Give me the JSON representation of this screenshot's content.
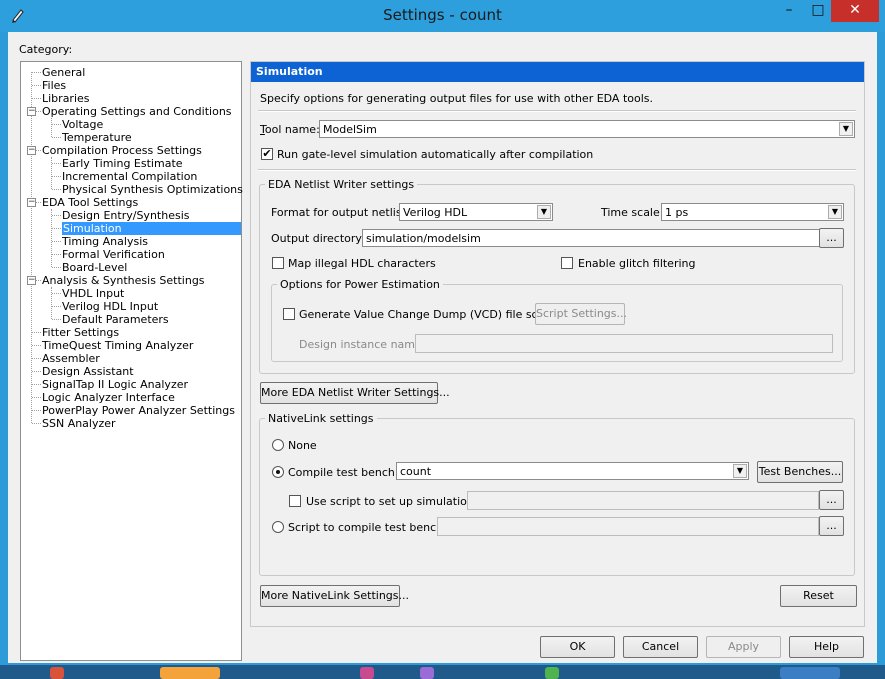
{
  "window": {
    "title": "Settings - count"
  },
  "titlebar": {
    "minimize": "–",
    "maximize": "□",
    "close": "✕"
  },
  "category_label": "Category:",
  "tree": [
    {
      "label": "General"
    },
    {
      "label": "Files"
    },
    {
      "label": "Libraries"
    },
    {
      "label": "Operating Settings and Conditions"
    },
    {
      "label": "Voltage"
    },
    {
      "label": "Temperature"
    },
    {
      "label": "Compilation Process Settings"
    },
    {
      "label": "Early Timing Estimate"
    },
    {
      "label": "Incremental Compilation"
    },
    {
      "label": "Physical Synthesis Optimizations"
    },
    {
      "label": "EDA Tool Settings"
    },
    {
      "label": "Design Entry/Synthesis"
    },
    {
      "label": "Simulation"
    },
    {
      "label": "Timing Analysis"
    },
    {
      "label": "Formal Verification"
    },
    {
      "label": "Board-Level"
    },
    {
      "label": "Analysis & Synthesis Settings"
    },
    {
      "label": "VHDL Input"
    },
    {
      "label": "Verilog HDL Input"
    },
    {
      "label": "Default Parameters"
    },
    {
      "label": "Fitter Settings"
    },
    {
      "label": "TimeQuest Timing Analyzer"
    },
    {
      "label": "Assembler"
    },
    {
      "label": "Design Assistant"
    },
    {
      "label": "SignalTap II Logic Analyzer"
    },
    {
      "label": "Logic Analyzer Interface"
    },
    {
      "label": "PowerPlay Power Analyzer Settings"
    },
    {
      "label": "SSN Analyzer"
    }
  ],
  "panel": {
    "title": "Simulation",
    "description": "Specify options for generating output files for use with other EDA tools.",
    "tool_name_label": "Tool name:",
    "tool_name_value": "ModelSim",
    "run_gate_level_label": "Run gate-level simulation automatically after compilation",
    "run_gate_level_checked": "✔",
    "netlist_group": {
      "title": "EDA Netlist Writer settings",
      "format_label": "Format for output netlist:",
      "format_value": "Verilog HDL",
      "time_scale_label": "Time scale:",
      "time_scale_value": "1 ps",
      "output_dir_label": "Output directory:",
      "output_dir_value": "simulation/modelsim",
      "browse": "...",
      "map_illegal_label": "Map illegal HDL characters",
      "glitch_label": "Enable glitch filtering",
      "power_group": {
        "title": "Options for Power Estimation",
        "vcd_label": "Generate Value Change Dump (VCD) file script",
        "script_settings_button": "Script Settings...",
        "design_instance_label": "Design instance name:"
      }
    },
    "more_netlist_button": "More EDA Netlist Writer Settings...",
    "nativelink_group": {
      "title": "NativeLink settings",
      "none_label": "None",
      "compile_tb_label": "Compile test bench:",
      "compile_tb_value": "count",
      "test_benches_button": "Test Benches...",
      "use_script_label": "Use script to set up simulation:",
      "script_compile_label": "Script to compile test bench:",
      "browse": "..."
    },
    "more_nativelink_button": "More NativeLink Settings...",
    "reset_button": "Reset"
  },
  "footer": {
    "ok": "OK",
    "cancel": "Cancel",
    "apply": "Apply",
    "help": "Help"
  },
  "colors": {
    "titlebar": "#2d9fdd",
    "selection": "#3399ff",
    "panel_header": "#0d62d4",
    "close": "#c7302a"
  }
}
